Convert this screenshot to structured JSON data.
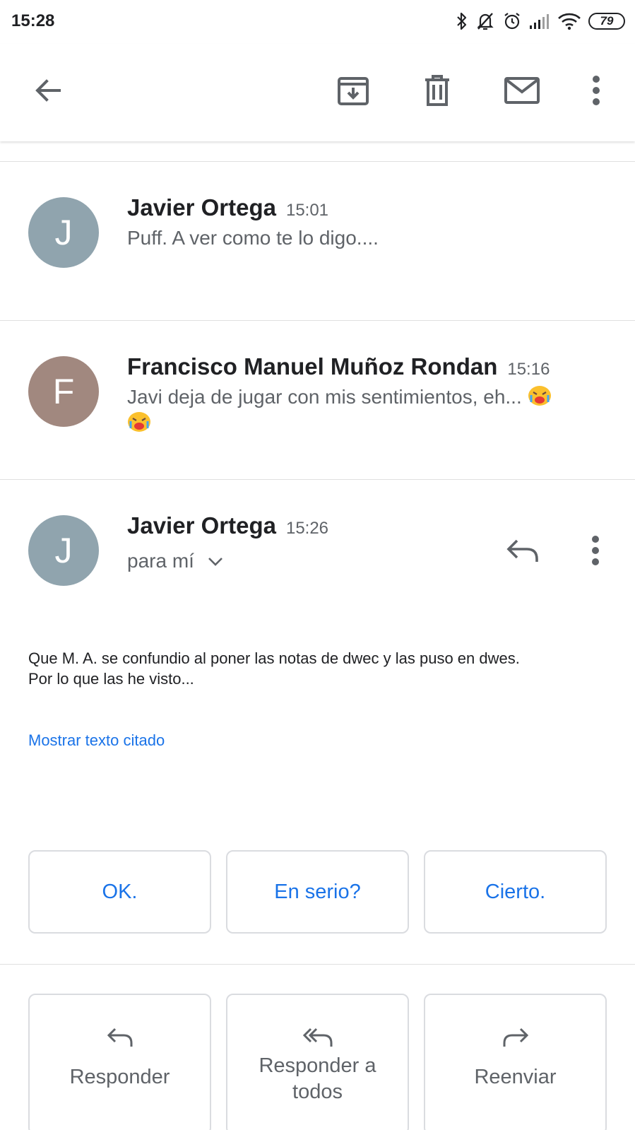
{
  "status_bar": {
    "time": "15:28",
    "battery": "79",
    "icons": [
      "bluetooth-icon",
      "muted-bell-icon",
      "alarm-icon",
      "signal-icon",
      "wifi-icon",
      "battery-icon"
    ]
  },
  "app_bar": {
    "icons": [
      "back-arrow-icon",
      "archive-icon",
      "trash-icon",
      "mail-unread-icon",
      "more-vert-icon"
    ]
  },
  "messages": [
    {
      "avatar_letter": "J",
      "avatar_color": "#90a4ae",
      "sender": "Javier Ortega",
      "time": "15:01",
      "snippet": "Puff. A ver como te lo digo...."
    },
    {
      "avatar_letter": "F",
      "avatar_color": "#a1887f",
      "sender": "Francisco Manuel Muñoz Rondan",
      "time": "15:16",
      "snippet": "Javi deja de jugar con mis sentimientos, eh...",
      "emoji": "crying-face-emoji"
    },
    {
      "avatar_letter": "J",
      "avatar_color": "#90a4ae",
      "sender": "Javier Ortega",
      "time": "15:26",
      "to": "para mí",
      "body_line1": "Que M. A. se confundio al poner las notas de dwec y las puso en dwes.",
      "body_line2": "Por lo que las he visto...",
      "show_quoted": "Mostrar texto citado"
    }
  ],
  "smart_replies": [
    "OK.",
    "En serio?",
    "Cierto."
  ],
  "actions": {
    "reply": "Responder",
    "reply_all_line1": "Responder a",
    "reply_all_line2": "todos",
    "forward": "Reenviar"
  },
  "colors": {
    "accent": "#1a73e8",
    "text_secondary": "#5f6368",
    "border": "#dadce0"
  }
}
